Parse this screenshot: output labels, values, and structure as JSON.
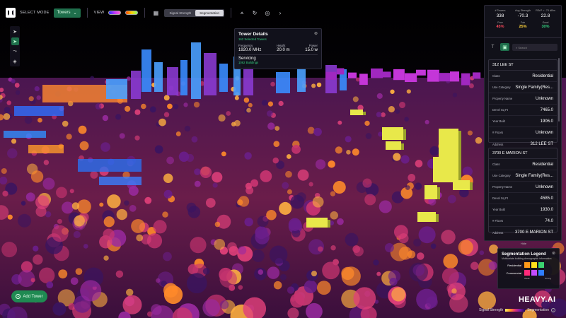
{
  "toolbar": {
    "select_mode_label": "SELECT MODE",
    "mode_value": "Towers",
    "view_label": "VIEW",
    "view_options": [
      "Signal Strength",
      "Segmentation"
    ],
    "active_view": "Segmentation"
  },
  "tower_popup": {
    "title": "Tower Details",
    "subtitle": "162 Selected Towers",
    "fields": [
      {
        "label": "Frequency",
        "value": "1920.0 MHz"
      },
      {
        "label": "Height",
        "value": "20.0 m"
      },
      {
        "label": "Power",
        "value": "15.0 w"
      }
    ],
    "servicing_label": "Servicing",
    "buildings": "1062 Buildings"
  },
  "stats": [
    {
      "label": "# Towers",
      "value": "338",
      "sub": "Poor",
      "pct": "45%",
      "color": "#ff4a5c"
    },
    {
      "label": "Avg Strength",
      "value": "-70.3",
      "sub": "Fair",
      "pct": "25%",
      "color": "#ffd43b"
    },
    {
      "label": "RSrP > -70 dBm",
      "value": "22.8",
      "sub": "Good",
      "pct": "30%",
      "color": "#35d07f"
    }
  ],
  "search": {
    "placeholder": "Search"
  },
  "buildings": [
    {
      "address_header": "312   LEE ST",
      "rows": [
        {
          "k": "Class",
          "v": "Residential"
        },
        {
          "k": "Use Category",
          "v": "Single Family(Res..."
        },
        {
          "k": "Property Name",
          "v": "Unknown"
        },
        {
          "k": "Devel Sq Ft",
          "v": "7465.0"
        },
        {
          "k": "Year Built",
          "v": "1906.0"
        },
        {
          "k": "# Floors",
          "v": "Unknown"
        },
        {
          "k": "Address",
          "v": "312   LEE ST"
        }
      ]
    },
    {
      "address_header": "3700   E MARION ST",
      "rows": [
        {
          "k": "Class",
          "v": "Residential"
        },
        {
          "k": "Use Category",
          "v": "Single Family(Res..."
        },
        {
          "k": "Property Name",
          "v": "Unknown"
        },
        {
          "k": "Devel Sq Ft",
          "v": "4585.0"
        },
        {
          "k": "Year Built",
          "v": "1930.0"
        },
        {
          "k": "# Floors",
          "v": "74.0"
        },
        {
          "k": "Address",
          "v": "3700   E MARION ST"
        }
      ]
    }
  ],
  "hide_label": "Hide",
  "legend": {
    "title": "Segmentation Legend",
    "subtitle": "Multivariate building demographic information",
    "rows": [
      {
        "label": "Residential",
        "colors": [
          "#ff9a1a",
          "#ffe01a",
          "#3bd16f"
        ]
      },
      {
        "label": "Commercial",
        "colors": [
          "#ff2a7a",
          "#c34bff",
          "#2f7dff"
        ]
      }
    ],
    "axis_low": "Weak",
    "axis_high": "Strong"
  },
  "add_tower_label": "Add Tower",
  "brand": "HEAVY.AI",
  "bottom_legend": {
    "signal": "Signal Strength",
    "segmentation": "Segmentation"
  },
  "colors": {
    "accent": "#1f6f4c",
    "good": "#35d07f"
  }
}
